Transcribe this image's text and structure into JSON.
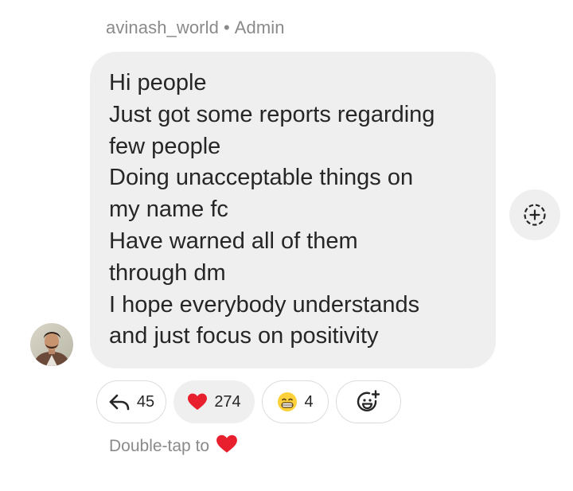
{
  "message": {
    "sender": "avinash_world",
    "separator": "•",
    "role": "Admin",
    "lines": [
      "Hi people",
      "Just got some reports regarding",
      "few people",
      "Doing unacceptable things on",
      "my name fc",
      "Have warned all of them",
      "through dm",
      "I hope everybody understands",
      "and just focus on positivity"
    ]
  },
  "reactions": {
    "reply": {
      "icon": "reply-arrow-icon",
      "count": "45"
    },
    "heart": {
      "icon": "heart-icon",
      "count": "274"
    },
    "grin": {
      "icon": "grinning-face-icon",
      "count": "4"
    },
    "add": {
      "icon": "add-emoji-icon"
    }
  },
  "hint": {
    "text": "Double-tap to",
    "icon": "heart-icon"
  },
  "colors": {
    "bubble": "#efefef",
    "text": "#262626",
    "muted": "#8a8a8a",
    "heart": "#e8202e"
  }
}
